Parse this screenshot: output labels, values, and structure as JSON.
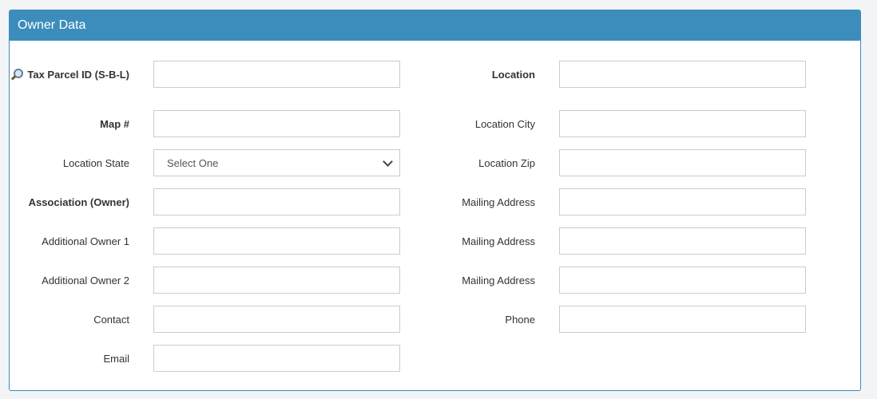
{
  "panel": {
    "title": "Owner Data"
  },
  "left_fields": [
    {
      "label": "Tax Parcel ID (S-B-L)",
      "bold": true,
      "value": ""
    },
    {
      "label": "Map #",
      "bold": true,
      "value": ""
    },
    {
      "label": "Location State",
      "bold": false,
      "selected": "Select One"
    },
    {
      "label": "Association (Owner)",
      "bold": true,
      "value": ""
    },
    {
      "label": "Additional Owner 1",
      "bold": false,
      "value": ""
    },
    {
      "label": "Additional Owner 2",
      "bold": false,
      "value": ""
    },
    {
      "label": "Contact",
      "bold": false,
      "value": ""
    },
    {
      "label": "Email",
      "bold": false,
      "value": ""
    }
  ],
  "right_fields": [
    {
      "label": "Location",
      "bold": true,
      "value": ""
    },
    {
      "label": "Location City",
      "bold": false,
      "value": ""
    },
    {
      "label": "Location Zip",
      "bold": false,
      "value": ""
    },
    {
      "label": "Mailing Address",
      "bold": false,
      "value": ""
    },
    {
      "label": "Mailing Address",
      "bold": false,
      "value": ""
    },
    {
      "label": "Mailing Address",
      "bold": false,
      "value": ""
    },
    {
      "label": "Phone",
      "bold": false,
      "value": ""
    }
  ]
}
